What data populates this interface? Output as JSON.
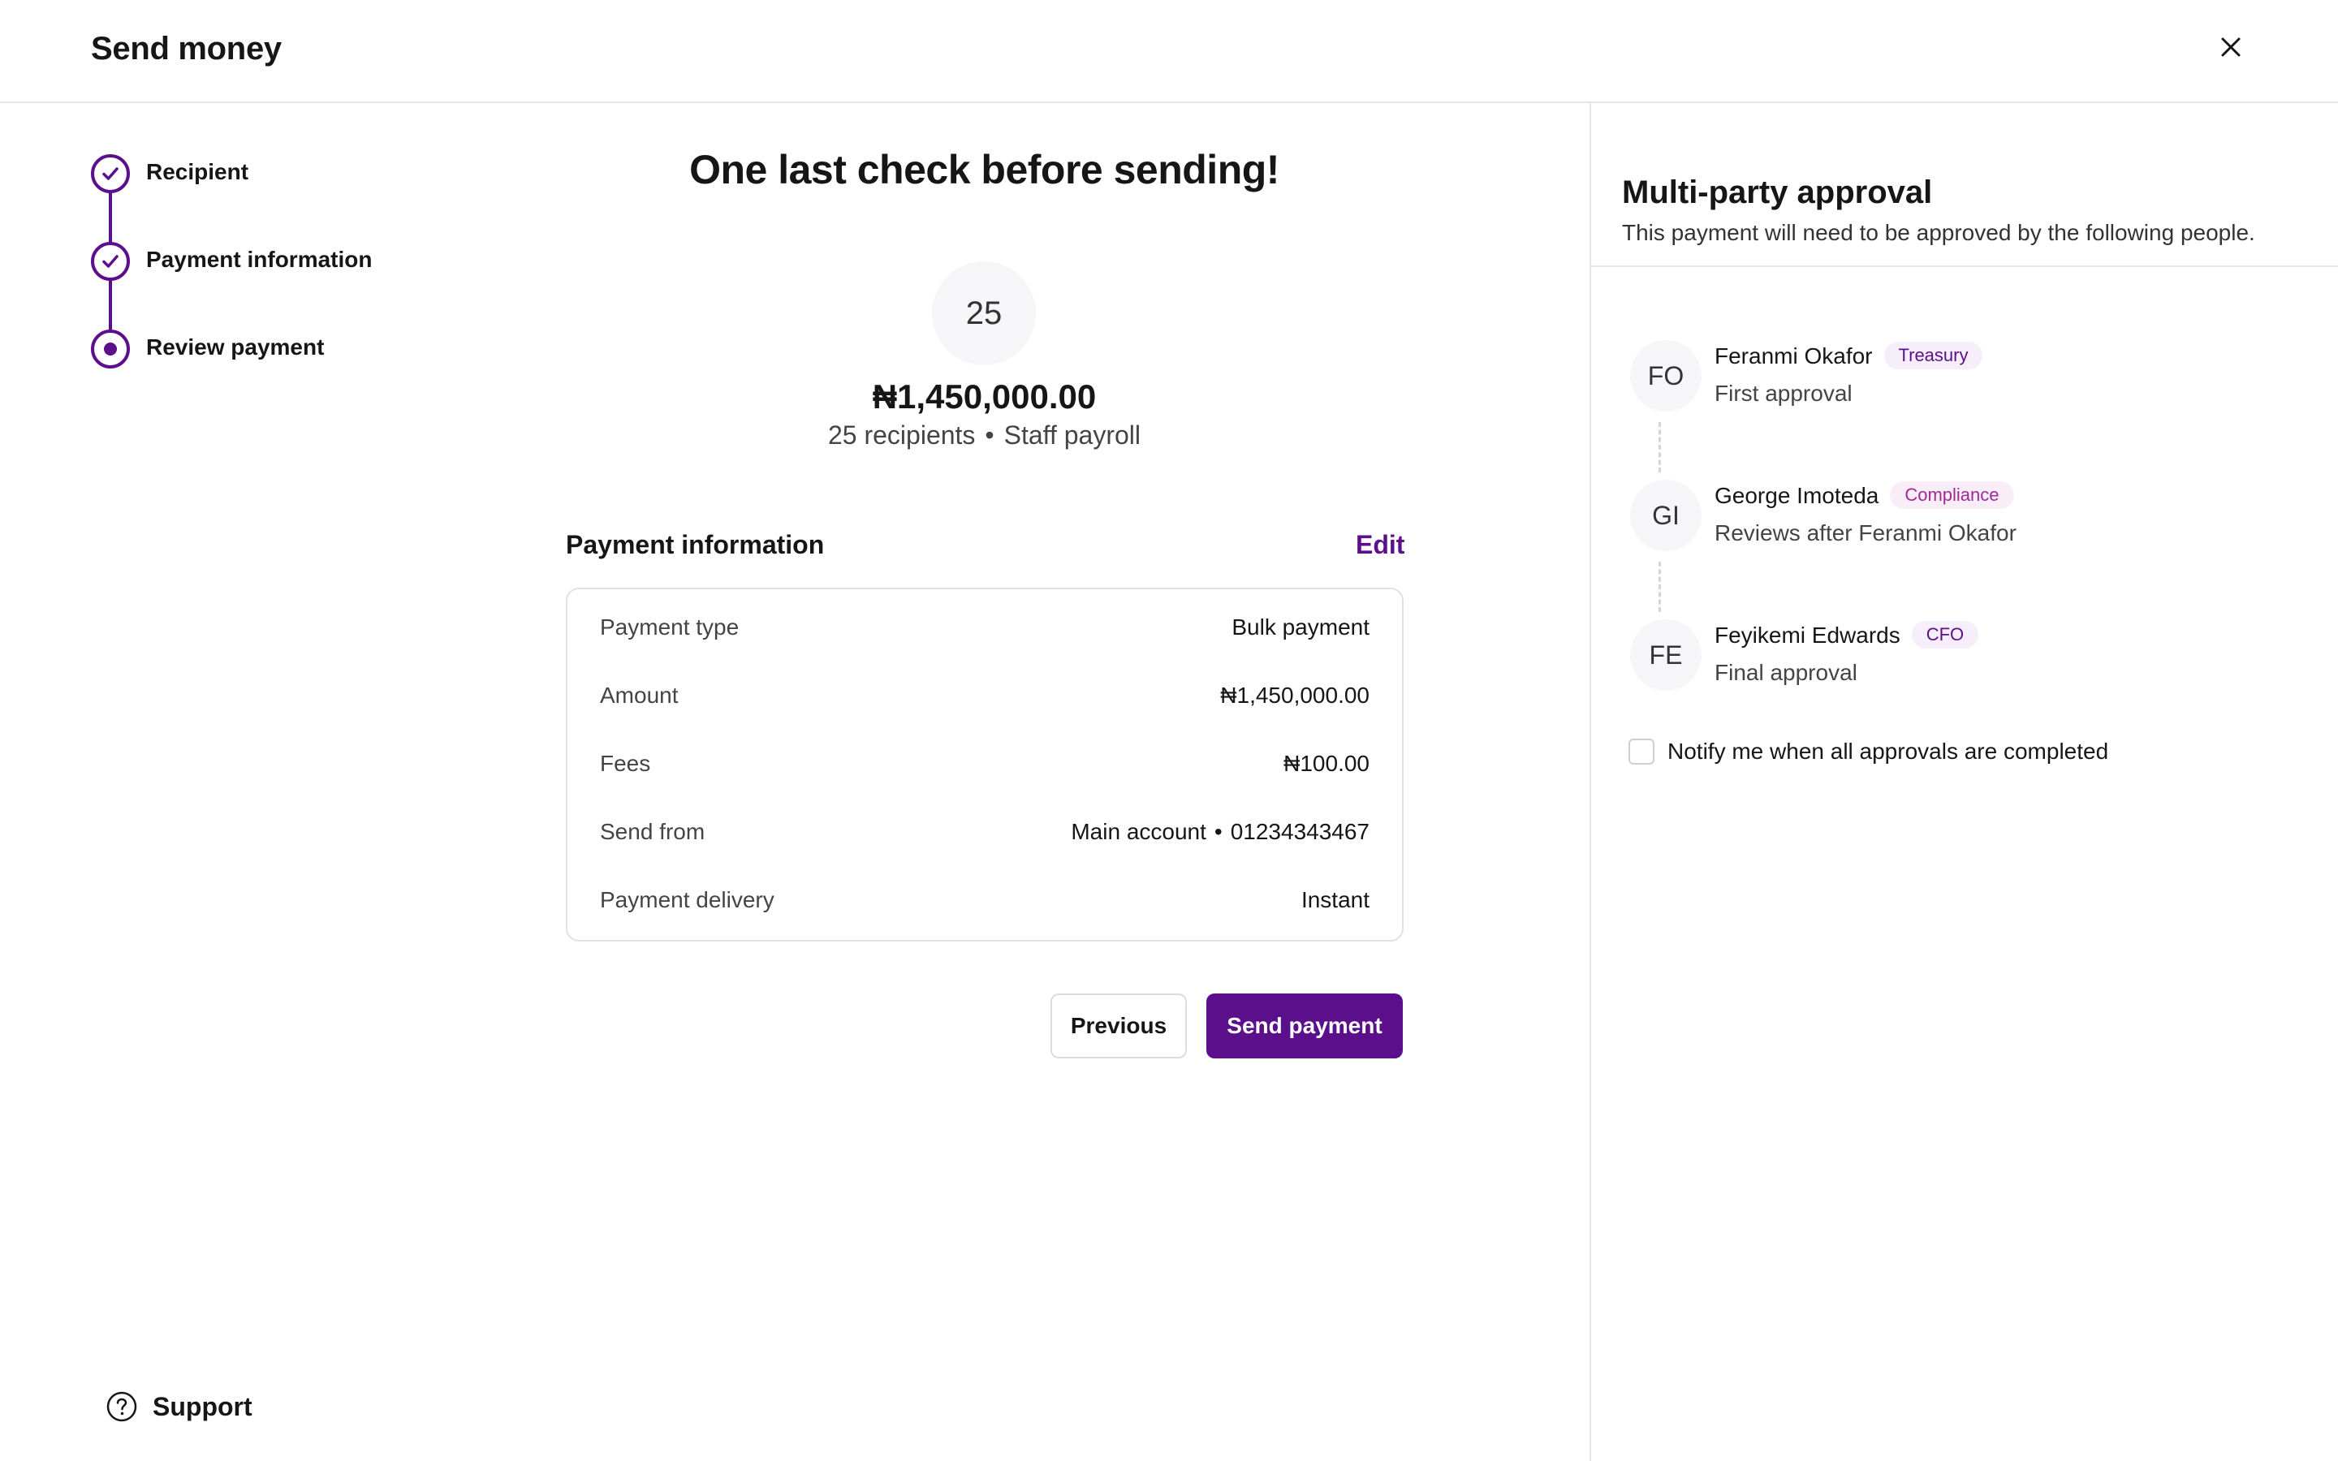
{
  "header": {
    "title": "Send money",
    "close_icon": "close-icon"
  },
  "stepper": {
    "steps": [
      {
        "label": "Recipient",
        "state": "completed"
      },
      {
        "label": "Payment information",
        "state": "completed"
      },
      {
        "label": "Review payment",
        "state": "current"
      }
    ]
  },
  "summary": {
    "title": "One last check before sending!",
    "recipient_count": "25",
    "amount": "₦1,450,000.00",
    "recipients_text": "25 recipients",
    "separator": "•",
    "description": "Staff payroll"
  },
  "payment_info": {
    "heading": "Payment information",
    "edit_label": "Edit",
    "rows": [
      {
        "label": "Payment type",
        "value": "Bulk payment"
      },
      {
        "label": "Amount",
        "value": "₦1,450,000.00"
      },
      {
        "label": "Fees",
        "value": "₦100.00"
      },
      {
        "label": "Send from",
        "value": "Main account",
        "value_extra": "01234343467",
        "separator": "•"
      },
      {
        "label": "Payment delivery",
        "value": "Instant"
      }
    ]
  },
  "actions": {
    "previous_label": "Previous",
    "send_label": "Send payment"
  },
  "support": {
    "label": "Support",
    "icon": "help-circle-icon"
  },
  "approval": {
    "title": "Multi-party approval",
    "subtitle": "This payment will need to be approved by the following people.",
    "approvers": [
      {
        "initials": "FO",
        "name": "Feranmi Okafor",
        "role": "Treasury",
        "note": "First approval",
        "badge_bg": "#f6eefa",
        "badge_color": "#5c0f8b"
      },
      {
        "initials": "GI",
        "name": "George Imoteda",
        "role": "Compliance",
        "note": "Reviews after Feranmi Okafor",
        "badge_bg": "#f9eef8",
        "badge_color": "#a0299a"
      },
      {
        "initials": "FE",
        "name": "Feyikemi Edwards",
        "role": "CFO",
        "note": "Final approval",
        "badge_bg": "#f6eefa",
        "badge_color": "#5c0f8b"
      }
    ],
    "notify_label": "Notify me when all approvals are completed",
    "notify_checked": false
  },
  "colors": {
    "accent": "#5c0f8b",
    "border": "#e6e6e6",
    "avatar_bg": "#f6f6f8"
  }
}
